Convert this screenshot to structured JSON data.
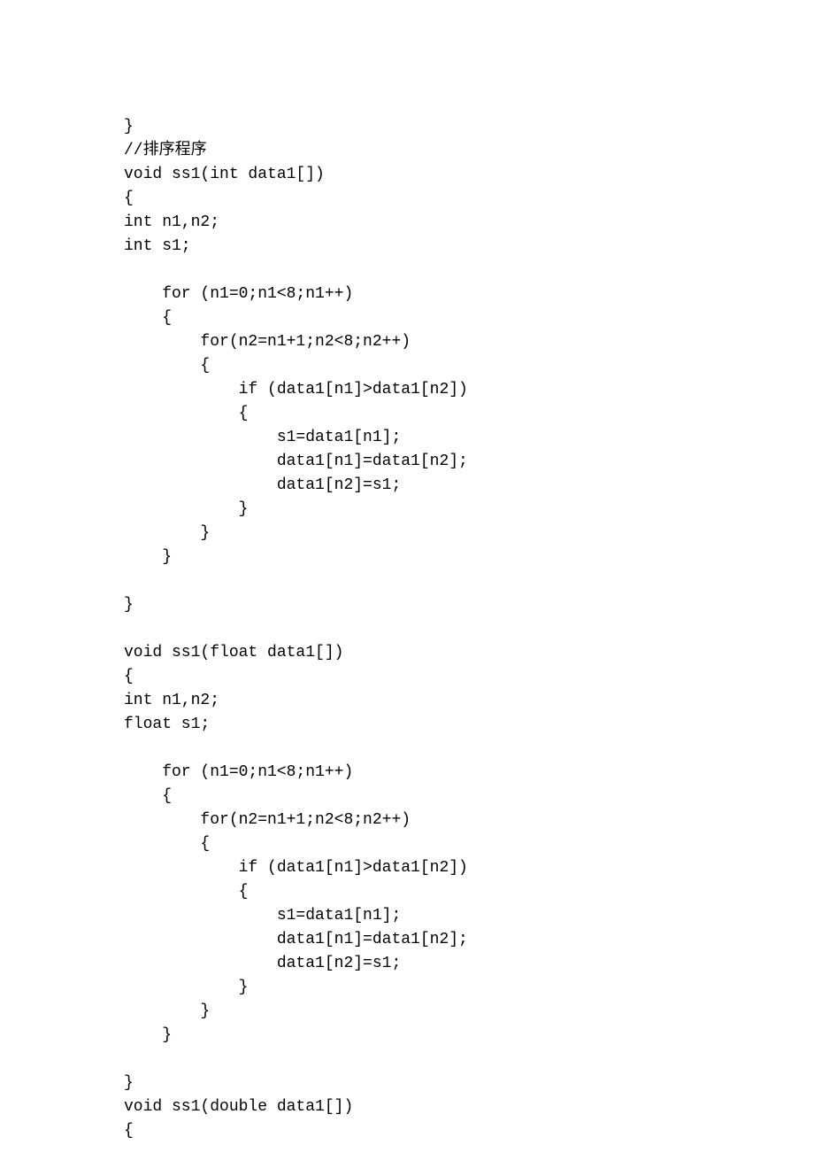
{
  "code": "}\n//排序程序\nvoid ss1(int data1[])\n{\nint n1,n2;\nint s1;\n\n    for (n1=0;n1<8;n1++)\n    {\n        for(n2=n1+1;n2<8;n2++)\n        {\n            if (data1[n1]>data1[n2])\n            {\n                s1=data1[n1];\n                data1[n1]=data1[n2];\n                data1[n2]=s1;\n            }\n        }\n    }\n\n}\n\nvoid ss1(float data1[])\n{\nint n1,n2;\nfloat s1;\n\n    for (n1=0;n1<8;n1++)\n    {\n        for(n2=n1+1;n2<8;n2++)\n        {\n            if (data1[n1]>data1[n2])\n            {\n                s1=data1[n1];\n                data1[n1]=data1[n2];\n                data1[n2]=s1;\n            }\n        }\n    }\n\n}\nvoid ss1(double data1[])\n{"
}
